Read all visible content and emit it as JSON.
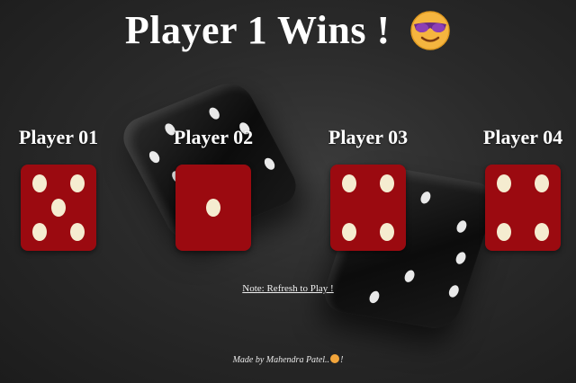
{
  "title": "Player 1 Wins !",
  "emoji_icon": "cool-face-sunglasses-emoji",
  "players": [
    {
      "label": "Player 01",
      "die_value": 5
    },
    {
      "label": "Player 02",
      "die_value": 1
    },
    {
      "label": "Player 03",
      "die_value": 4
    },
    {
      "label": "Player 04",
      "die_value": 4
    }
  ],
  "note": "Note: Refresh to Play !",
  "footer": {
    "prefix": "Made by Mahendra Patel..",
    "suffix": "!"
  },
  "colors": {
    "die_face": "#9b0a10",
    "pip": "#f5ecd0",
    "background": "#2a2a2a"
  }
}
